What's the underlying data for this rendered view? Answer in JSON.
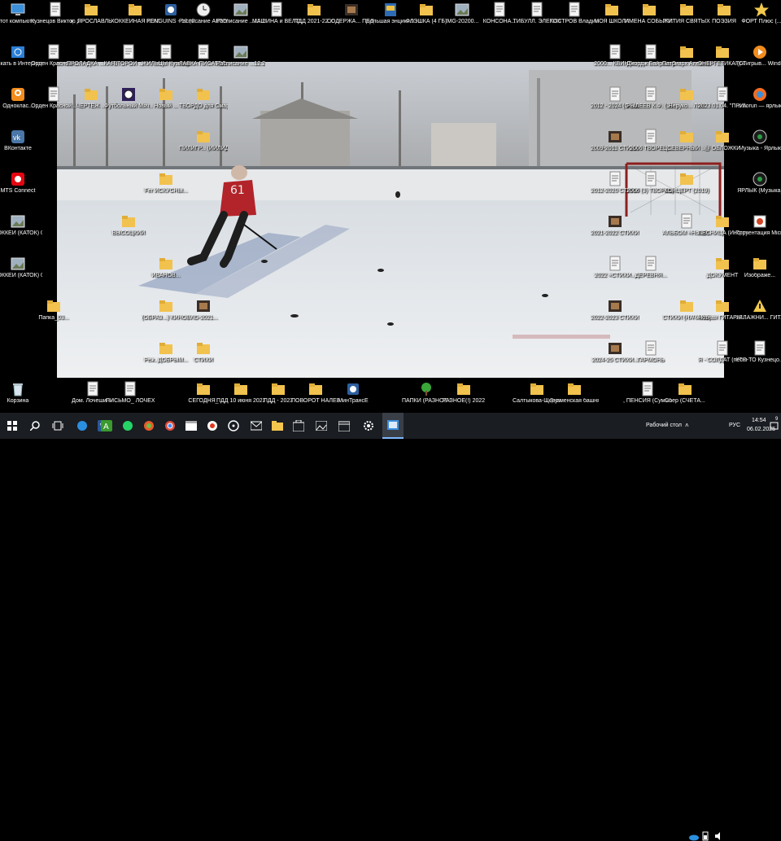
{
  "left_icons": [
    {
      "label": "Этот компьюте...",
      "kind": "pc"
    },
    {
      "label": "Искать в Интернете",
      "kind": "globe"
    },
    {
      "label": "Одноклас...",
      "kind": "ok"
    },
    {
      "label": "ВКонтакте",
      "kind": "vk"
    },
    {
      "label": "MTS Connect",
      "kind": "mts"
    },
    {
      "label": "ХОККЕЙ (КАТОК) 01",
      "kind": "img"
    },
    {
      "label": "ХОККЕЙ (КАТОК) 02",
      "kind": "img"
    },
    {
      "label": "Папка_03...",
      "kind": "folder"
    },
    {
      "label": "Корзина",
      "kind": "bin"
    }
  ],
  "top_icons": [
    {
      "label": "Кузнецов Виктор Дм...",
      "kind": "doc"
    },
    {
      "label": "ж. ЯРОСЛАВЛЬ",
      "kind": "folder"
    },
    {
      "label": "ХОККЕЙНАЯ КОМАНДА",
      "kind": "folder"
    },
    {
      "label": "PENGUINS - 13 (С))",
      "kind": "app"
    },
    {
      "label": "Расписание АВТОБУСОВ",
      "kind": "clock"
    },
    {
      "label": "Расписание ...12.2024))",
      "kind": "img"
    },
    {
      "label": "МАШИНА и ВЕЛОСИПЕД",
      "kind": "doc"
    },
    {
      "label": "ПДД 2021-22 гг",
      "kind": "folder"
    },
    {
      "label": "СОДЕРЖА... ПДД 2021",
      "kind": "film"
    },
    {
      "label": "Большая энциклоп...",
      "kind": "book"
    },
    {
      "label": "ФЛЭШКА (4 ГБ)",
      "kind": "folder"
    },
    {
      "label": "IMG-20200...",
      "kind": "img"
    },
    {
      "label": "КОНСОНА...",
      "kind": "doc"
    },
    {
      "label": "ТИБУЛЛ. ЭЛЕГИИ",
      "kind": "doc"
    },
    {
      "label": "КОСТРОВ Владими...",
      "kind": "doc"
    },
    {
      "label": "МОЯ ШКОЛА",
      "kind": "folder"
    },
    {
      "label": "ИМЕНА СОБЫТИ...",
      "kind": "folder"
    },
    {
      "label": "ЖИТИЯ СВЯТЫХ",
      "kind": "folder"
    },
    {
      "label": "ПОЭЗИЯ",
      "kind": "folder"
    },
    {
      "label": "ФОРТ Плюс (...",
      "kind": "star"
    }
  ],
  "right_icons": [
    {
      "label": "Проигрыв... Windows ...",
      "kind": "media"
    },
    {
      "label": "autorun — ярлык",
      "kind": "fire"
    },
    {
      "label": "Музыка - Ярлык",
      "kind": "music"
    },
    {
      "label": "ЯРЛЫК (Музыка)",
      "kind": "music"
    },
    {
      "label": "Презентация Microsoft P...",
      "kind": "ppt"
    },
    {
      "label": "Изображе...",
      "kind": "folder"
    },
    {
      "label": "УВЛАЖНИ... ГИТАРЫ",
      "kind": "warn"
    },
    {
      "label": "КТО-ТО Кузнецо...",
      "kind": "doc"
    }
  ],
  "inner_right_icons": [
    {
      "label": "2000... КВИНТ...",
      "kind": "doc"
    },
    {
      "label": "Джордж Байрон. Ст...",
      "kind": "doc"
    },
    {
      "label": "Патриарх Алексий II",
      "kind": "folder"
    },
    {
      "label": "ЭНЕРГЕТИКА (СТИХА)",
      "kind": "folder"
    },
    {
      "label": "2012 - 2024 (Оглавлен...",
      "kind": "doc"
    },
    {
      "label": "РЫЛЕЕВ К.Ф. (18 сентяб...",
      "kind": "doc"
    },
    {
      "label": "Неруко... ЛИК",
      "kind": "folder"
    },
    {
      "label": "2023.01.04. \"ПРИМЕР...",
      "kind": "doc"
    },
    {
      "label": "2009-2011 СТИХИ (Н...",
      "kind": "film"
    },
    {
      "label": "2006 ТВОРЕЦ...",
      "kind": "doc"
    },
    {
      "label": "СЕВЕРНЫЙ ...",
      "kind": "folder"
    },
    {
      "label": "@ ОБЛОЖКИ",
      "kind": "folder"
    },
    {
      "label": "2012-2020 СТИХИ ...",
      "kind": "doc"
    },
    {
      "label": "2006 (3) ТВОРЕЦ. Да...",
      "kind": "doc"
    },
    {
      "label": "КОНЦЕРТ (2019)",
      "kind": "folder"
    },
    {
      "label": "2021-2022 СТИХИ (Н...",
      "kind": "film"
    },
    {
      "label": "АЛЬБОМ «Новая...",
      "kind": "doc"
    },
    {
      "label": "ПЕСНИЦА (Инструкц...",
      "kind": "folder"
    },
    {
      "label": "2022 «СТИХИ...",
      "kind": "doc"
    },
    {
      "label": "ДЕРЕВНЯ...",
      "kind": "doc"
    },
    {
      "label": "ДОКУМЕНТ",
      "kind": "folder"
    },
    {
      "label": "2022-2023 СТИХИ (Н...",
      "kind": "film"
    },
    {
      "label": "СТИХИ (НАЧАЛО)",
      "kind": "folder"
    },
    {
      "label": "Нотная ГИТАРЫ...",
      "kind": "folder"
    },
    {
      "label": "2024-25 СТИХИ...",
      "kind": "film"
    },
    {
      "label": "ГАРМОНЬ",
      "kind": "doc"
    },
    {
      "label": "Я - СОЛДАТ (песня)",
      "kind": "doc"
    }
  ],
  "inner_left_icons": [
    {
      "label": "Орден Красной...",
      "kind": "doc"
    },
    {
      "label": "ПРОЛАДКА ...КАРТЫ...",
      "kind": "doc"
    },
    {
      "label": "ВТОРОЙ ...",
      "kind": "doc"
    },
    {
      "label": "ЖИЛЬЦЫ Кузнецо...",
      "kind": "doc"
    },
    {
      "label": "ЛАВКА ПИСАТЕЛ...",
      "kind": "doc"
    },
    {
      "label": "Расписание ...12.2024))",
      "kind": "img"
    },
    {
      "label": "Орден Красной...",
      "kind": "doc"
    },
    {
      "label": "ЧЕРТЕЖ ...",
      "kind": "folder"
    },
    {
      "label": "Футбольный Мяч...",
      "kind": "ball"
    },
    {
      "label": "Новый ...",
      "kind": "folder"
    },
    {
      "label": "ТВОРДО для Смартфонов",
      "kind": "folder"
    },
    {
      "label": "ПИЛИГР... (ИИЛИДЕ...)",
      "kind": "folder"
    },
    {
      "label": "Fer ИСКУСНЫ...",
      "kind": "folder"
    },
    {
      "label": "ВЫСОЦКИЙ",
      "kind": "folder"
    },
    {
      "label": "ИВАНОВ...",
      "kind": "folder"
    },
    {
      "label": "(ОБРАЗ...) КИНОВ...",
      "kind": "folder"
    },
    {
      "label": "VID-2021...",
      "kind": "film"
    },
    {
      "label": "Реж. ДОБРЫМ...",
      "kind": "folder"
    },
    {
      "label": "СТИХИ",
      "kind": "folder"
    }
  ],
  "bottom_icons": [
    {
      "label": "Дом. Лочешины",
      "kind": "doc"
    },
    {
      "label": "ПИСЬМО_ ЛОЧЕХИН...",
      "kind": "doc"
    },
    {
      "label": "СЕГОДНЯ_",
      "kind": "folder"
    },
    {
      "label": "ПДД 10 июня 2023",
      "kind": "folder"
    },
    {
      "label": "ПДД - 2023",
      "kind": "folder"
    },
    {
      "label": "ПОВОРОТ НАЛЕВО...",
      "kind": "folder"
    },
    {
      "label": "МинТрансЕ",
      "kind": "app"
    },
    {
      "label": "ПАПКИ (РАЗНОЕ !)",
      "kind": "tree"
    },
    {
      "label": "РАЗНОЕ(!) 2022",
      "kind": "folder"
    },
    {
      "label": "Салтыкова-Щедрина, 18",
      "kind": "folder"
    },
    {
      "label": "Знаменская башня",
      "kind": "folder"
    },
    {
      "label": ", ПЕНСИЯ (Сумма!)",
      "kind": "doc"
    },
    {
      "label": "Сбер (СЧЕТА...",
      "kind": "folder"
    }
  ],
  "taskbar": {
    "desktop_label": "Рабочий стол",
    "language": "РУС",
    "time": "14:54",
    "date": "06.02.2025",
    "notification_count": "9"
  },
  "wallpaper": {
    "jersey_number": "61"
  }
}
